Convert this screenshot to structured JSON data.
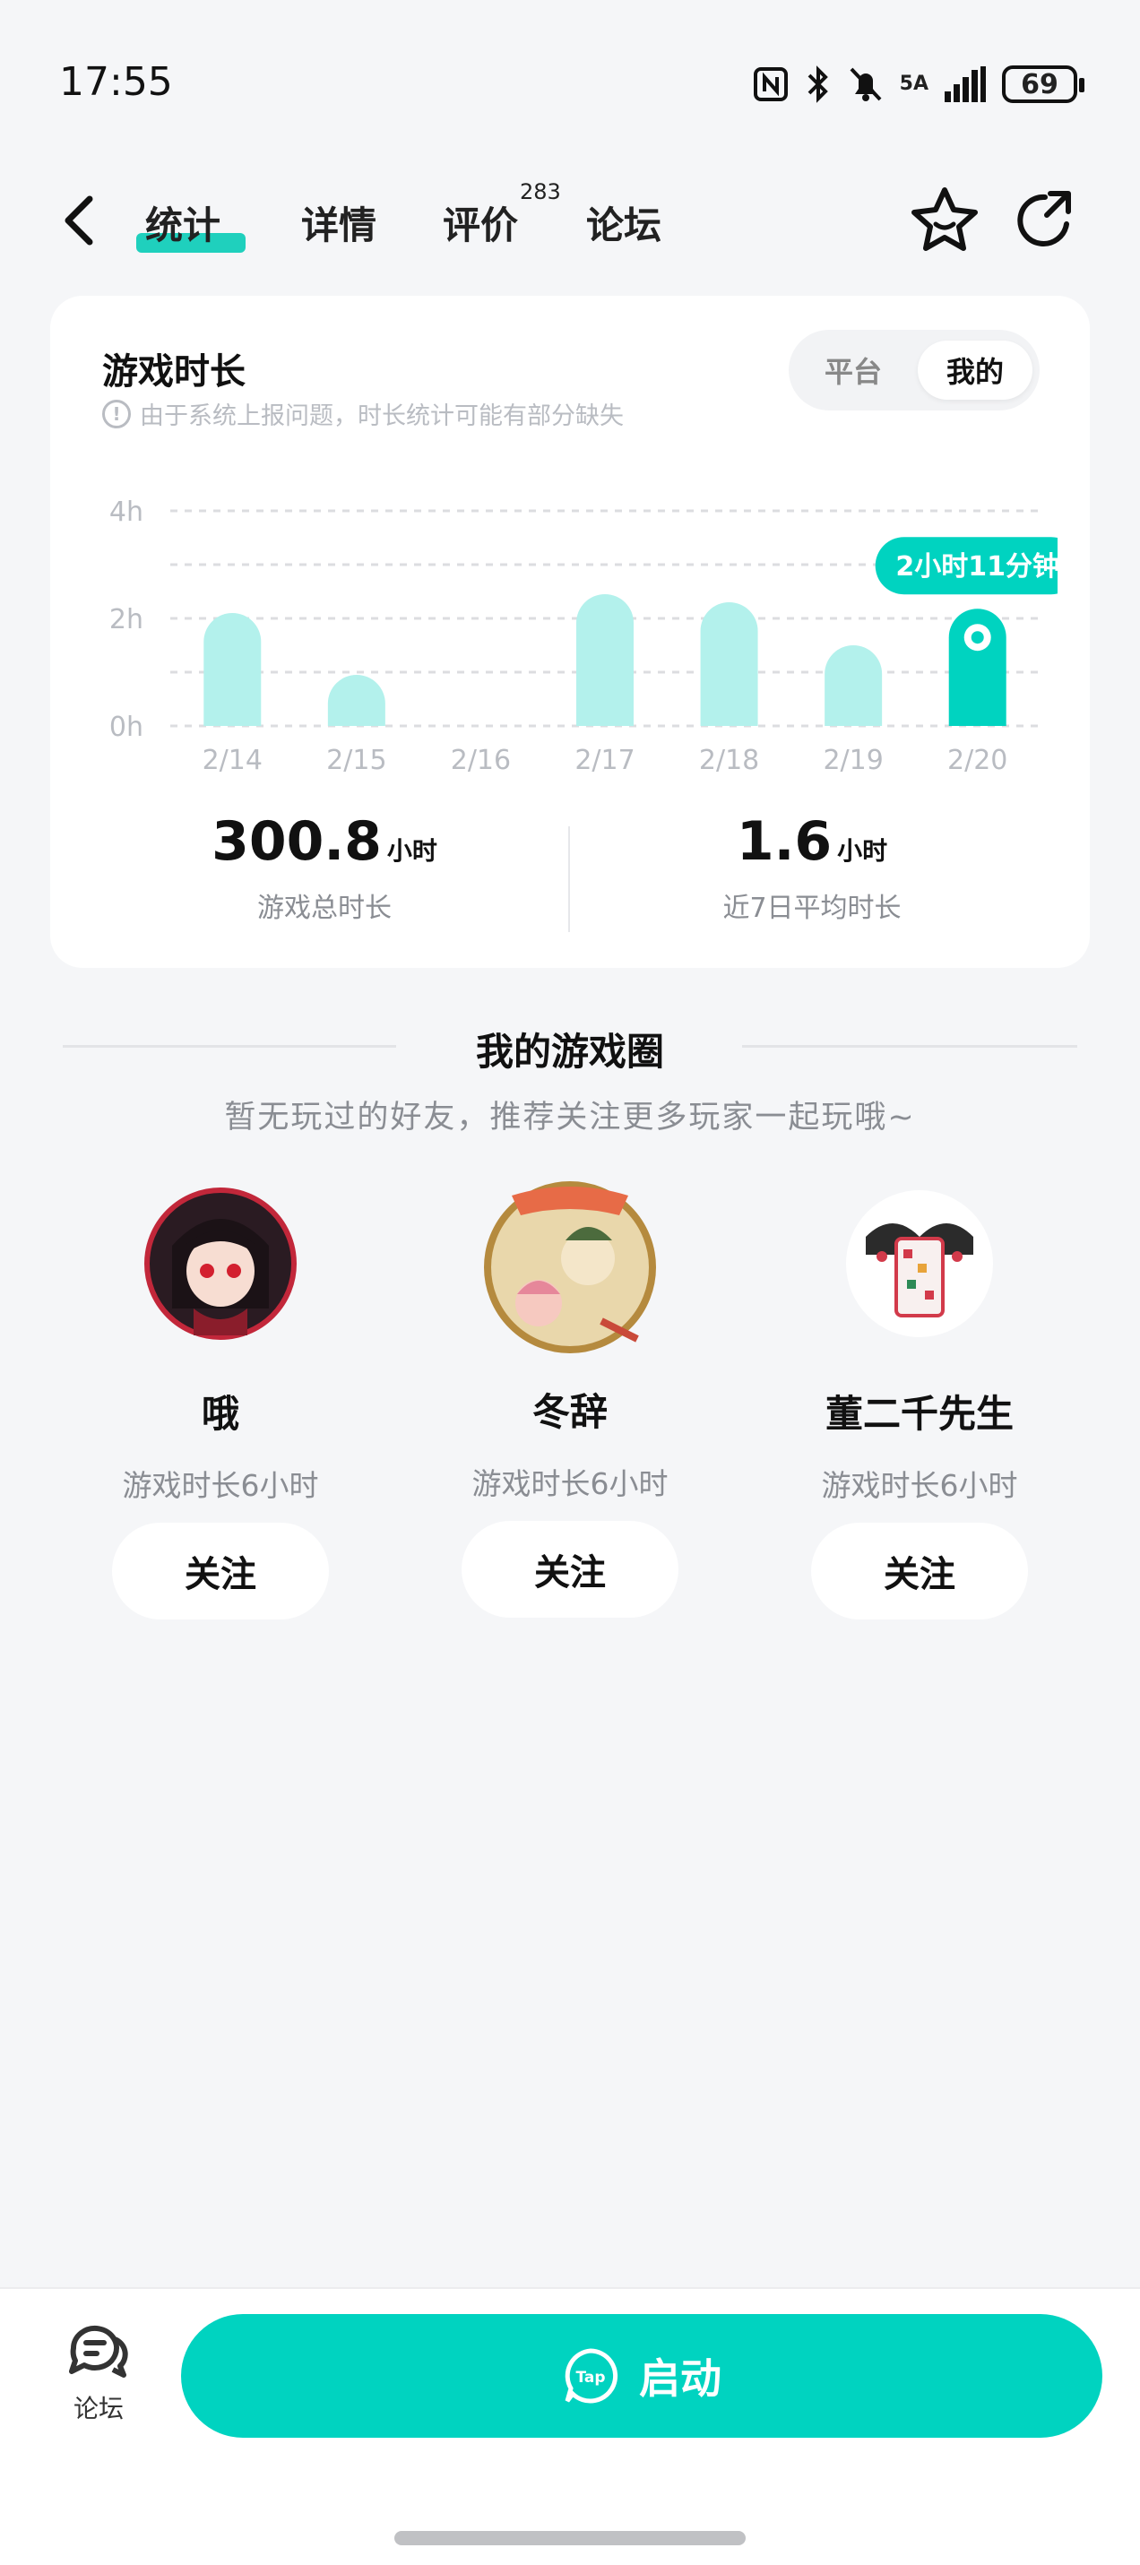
{
  "status_bar": {
    "time": "17:55",
    "network": "5A",
    "battery": "69"
  },
  "nav": {
    "tabs": [
      {
        "label": "统计",
        "active": true
      },
      {
        "label": "详情"
      },
      {
        "label": "评价",
        "badge": "283"
      },
      {
        "label": "论坛"
      }
    ],
    "icons": [
      "back-icon",
      "star-icon",
      "share-icon"
    ]
  },
  "playtime_card": {
    "title": "游戏时长",
    "note": "由于系统上报问题，时长统计可能有部分缺失",
    "toggle": {
      "options": [
        "平台",
        "我的"
      ],
      "selected": "我的"
    },
    "stats": [
      {
        "value": "300.8",
        "unit": "小时",
        "label": "游戏总时长"
      },
      {
        "value": "1.6",
        "unit": "小时",
        "label": "近7日平均时长"
      }
    ]
  },
  "chart_data": {
    "type": "bar",
    "categories": [
      "2/14",
      "2/15",
      "2/16",
      "2/17",
      "2/18",
      "2/19",
      "2/20"
    ],
    "values": [
      2.1,
      0.95,
      0,
      2.45,
      2.3,
      1.5,
      2.18
    ],
    "y_ticks": [
      "0h",
      "2h",
      "4h"
    ],
    "ylim": [
      0,
      4
    ],
    "highlight_index": 6,
    "highlight_label": "2小时11分钟",
    "colors": {
      "bar": "#b3f1ec",
      "highlight": "#00d3c0",
      "grid": "#dcdde0"
    }
  },
  "game_circle": {
    "title": "我的游戏圈",
    "subtitle": "暂无玩过的好友，推荐关注更多玩家一起玩哦~",
    "friends": [
      {
        "name": "哦",
        "meta": "游戏时长6小时",
        "button": "关注"
      },
      {
        "name": "冬辞",
        "meta": "游戏时长6小时",
        "button": "关注"
      },
      {
        "name": "董二千先生",
        "meta": "游戏时长6小时",
        "button": "关注"
      }
    ]
  },
  "bottom_bar": {
    "forum_label": "论坛",
    "launch_label": "启动",
    "launch_logo": "Tap"
  },
  "colors": {
    "accent": "#00d3c0",
    "accent_light": "#1fd0bd",
    "background": "#f5f6f8"
  }
}
